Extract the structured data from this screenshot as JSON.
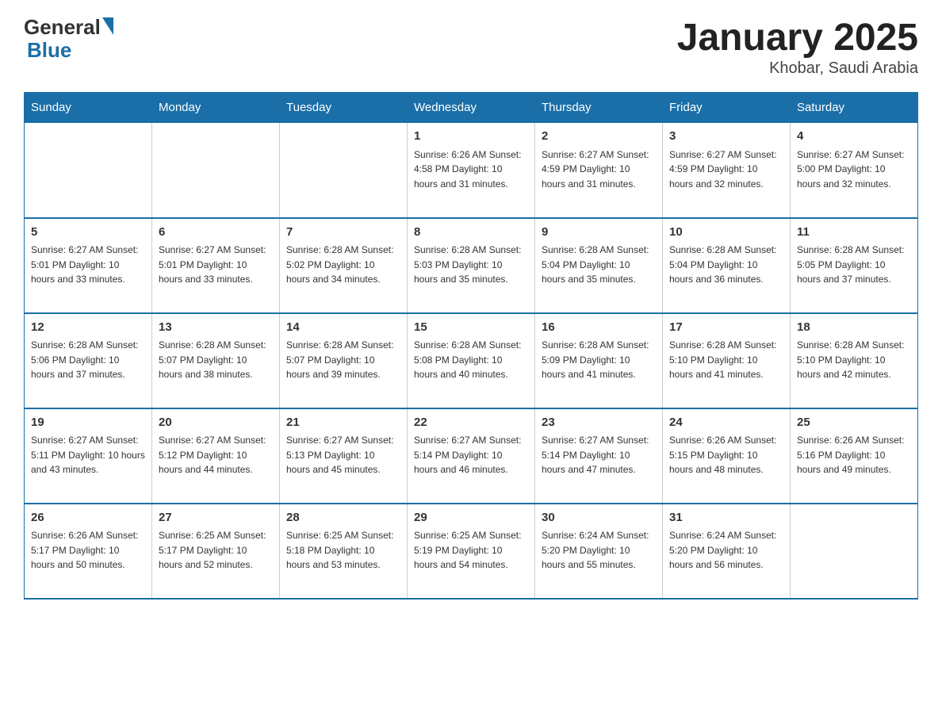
{
  "header": {
    "logo_general": "General",
    "logo_blue": "Blue",
    "title": "January 2025",
    "subtitle": "Khobar, Saudi Arabia"
  },
  "weekdays": [
    "Sunday",
    "Monday",
    "Tuesday",
    "Wednesday",
    "Thursday",
    "Friday",
    "Saturday"
  ],
  "weeks": [
    [
      {
        "day": "",
        "info": ""
      },
      {
        "day": "",
        "info": ""
      },
      {
        "day": "",
        "info": ""
      },
      {
        "day": "1",
        "info": "Sunrise: 6:26 AM\nSunset: 4:58 PM\nDaylight: 10 hours and 31 minutes."
      },
      {
        "day": "2",
        "info": "Sunrise: 6:27 AM\nSunset: 4:59 PM\nDaylight: 10 hours and 31 minutes."
      },
      {
        "day": "3",
        "info": "Sunrise: 6:27 AM\nSunset: 4:59 PM\nDaylight: 10 hours and 32 minutes."
      },
      {
        "day": "4",
        "info": "Sunrise: 6:27 AM\nSunset: 5:00 PM\nDaylight: 10 hours and 32 minutes."
      }
    ],
    [
      {
        "day": "5",
        "info": "Sunrise: 6:27 AM\nSunset: 5:01 PM\nDaylight: 10 hours and 33 minutes."
      },
      {
        "day": "6",
        "info": "Sunrise: 6:27 AM\nSunset: 5:01 PM\nDaylight: 10 hours and 33 minutes."
      },
      {
        "day": "7",
        "info": "Sunrise: 6:28 AM\nSunset: 5:02 PM\nDaylight: 10 hours and 34 minutes."
      },
      {
        "day": "8",
        "info": "Sunrise: 6:28 AM\nSunset: 5:03 PM\nDaylight: 10 hours and 35 minutes."
      },
      {
        "day": "9",
        "info": "Sunrise: 6:28 AM\nSunset: 5:04 PM\nDaylight: 10 hours and 35 minutes."
      },
      {
        "day": "10",
        "info": "Sunrise: 6:28 AM\nSunset: 5:04 PM\nDaylight: 10 hours and 36 minutes."
      },
      {
        "day": "11",
        "info": "Sunrise: 6:28 AM\nSunset: 5:05 PM\nDaylight: 10 hours and 37 minutes."
      }
    ],
    [
      {
        "day": "12",
        "info": "Sunrise: 6:28 AM\nSunset: 5:06 PM\nDaylight: 10 hours and 37 minutes."
      },
      {
        "day": "13",
        "info": "Sunrise: 6:28 AM\nSunset: 5:07 PM\nDaylight: 10 hours and 38 minutes."
      },
      {
        "day": "14",
        "info": "Sunrise: 6:28 AM\nSunset: 5:07 PM\nDaylight: 10 hours and 39 minutes."
      },
      {
        "day": "15",
        "info": "Sunrise: 6:28 AM\nSunset: 5:08 PM\nDaylight: 10 hours and 40 minutes."
      },
      {
        "day": "16",
        "info": "Sunrise: 6:28 AM\nSunset: 5:09 PM\nDaylight: 10 hours and 41 minutes."
      },
      {
        "day": "17",
        "info": "Sunrise: 6:28 AM\nSunset: 5:10 PM\nDaylight: 10 hours and 41 minutes."
      },
      {
        "day": "18",
        "info": "Sunrise: 6:28 AM\nSunset: 5:10 PM\nDaylight: 10 hours and 42 minutes."
      }
    ],
    [
      {
        "day": "19",
        "info": "Sunrise: 6:27 AM\nSunset: 5:11 PM\nDaylight: 10 hours and 43 minutes."
      },
      {
        "day": "20",
        "info": "Sunrise: 6:27 AM\nSunset: 5:12 PM\nDaylight: 10 hours and 44 minutes."
      },
      {
        "day": "21",
        "info": "Sunrise: 6:27 AM\nSunset: 5:13 PM\nDaylight: 10 hours and 45 minutes."
      },
      {
        "day": "22",
        "info": "Sunrise: 6:27 AM\nSunset: 5:14 PM\nDaylight: 10 hours and 46 minutes."
      },
      {
        "day": "23",
        "info": "Sunrise: 6:27 AM\nSunset: 5:14 PM\nDaylight: 10 hours and 47 minutes."
      },
      {
        "day": "24",
        "info": "Sunrise: 6:26 AM\nSunset: 5:15 PM\nDaylight: 10 hours and 48 minutes."
      },
      {
        "day": "25",
        "info": "Sunrise: 6:26 AM\nSunset: 5:16 PM\nDaylight: 10 hours and 49 minutes."
      }
    ],
    [
      {
        "day": "26",
        "info": "Sunrise: 6:26 AM\nSunset: 5:17 PM\nDaylight: 10 hours and 50 minutes."
      },
      {
        "day": "27",
        "info": "Sunrise: 6:25 AM\nSunset: 5:17 PM\nDaylight: 10 hours and 52 minutes."
      },
      {
        "day": "28",
        "info": "Sunrise: 6:25 AM\nSunset: 5:18 PM\nDaylight: 10 hours and 53 minutes."
      },
      {
        "day": "29",
        "info": "Sunrise: 6:25 AM\nSunset: 5:19 PM\nDaylight: 10 hours and 54 minutes."
      },
      {
        "day": "30",
        "info": "Sunrise: 6:24 AM\nSunset: 5:20 PM\nDaylight: 10 hours and 55 minutes."
      },
      {
        "day": "31",
        "info": "Sunrise: 6:24 AM\nSunset: 5:20 PM\nDaylight: 10 hours and 56 minutes."
      },
      {
        "day": "",
        "info": ""
      }
    ]
  ]
}
